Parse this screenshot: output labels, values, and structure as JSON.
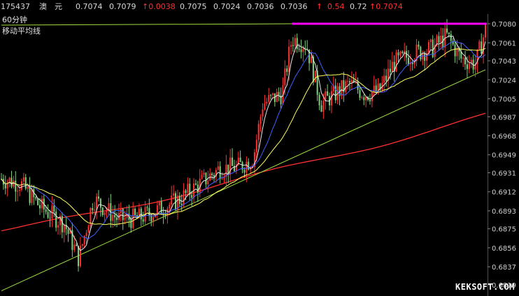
{
  "quote": {
    "code": "175437",
    "name": "澳　元",
    "v1": "0.7074",
    "v2": "0.7079",
    "change": "↑0.0038",
    "v3": "0.7075",
    "v4": "0.7024",
    "v5": "0.7036",
    "v6": "0.7036",
    "arrow": "↑",
    "v7": "0.54",
    "v8": "0.72",
    "v9": "↑0.7074"
  },
  "chart_labels": {
    "period": "60分钟",
    "indicator": "移动平均线"
  },
  "watermark": "KEKSOFT.COM",
  "colors": {
    "background": "#000000",
    "up_candle": "#ff3030",
    "down_candle": "#7fd07f",
    "ma_fast": "#e8e8e8",
    "ma_mid": "#ffff60",
    "ma_blue": "#4060ff",
    "ma_long": "#ff3030",
    "trendline": "#a0e040",
    "resistance": "#ff00ff"
  },
  "chart_data": {
    "type": "candlestick",
    "y_ticks": [
      "0.7080",
      "0.7061",
      "0.7043",
      "0.7024",
      "0.7005",
      "0.6987",
      "0.6968",
      "0.6949",
      "0.6931",
      "0.6912",
      "0.6893",
      "0.6875",
      "0.6856",
      "0.6837",
      "0.6819"
    ],
    "ylim": [
      0.6812,
      0.7087
    ],
    "resistance_level": 0.708,
    "trendline": {
      "start": [
        0,
        0.6813
      ],
      "end": [
        1,
        0.7034
      ]
    },
    "long_ma_start": 0.6873,
    "long_ma_end": 0.6988,
    "path_anchors": [
      [
        0,
        0.6925
      ],
      [
        0.04,
        0.692
      ],
      [
        0.08,
        0.6897
      ],
      [
        0.13,
        0.688
      ],
      [
        0.16,
        0.6845
      ],
      [
        0.19,
        0.6905
      ],
      [
        0.24,
        0.6885
      ],
      [
        0.28,
        0.6885
      ],
      [
        0.33,
        0.6895
      ],
      [
        0.37,
        0.6905
      ],
      [
        0.41,
        0.692
      ],
      [
        0.45,
        0.6935
      ],
      [
        0.49,
        0.6937
      ],
      [
        0.52,
        0.6945
      ],
      [
        0.54,
        0.7
      ],
      [
        0.58,
        0.701
      ],
      [
        0.6,
        0.7065
      ],
      [
        0.63,
        0.706
      ],
      [
        0.66,
        0.7
      ],
      [
        0.69,
        0.701
      ],
      [
        0.72,
        0.702
      ],
      [
        0.75,
        0.701
      ],
      [
        0.78,
        0.7012
      ],
      [
        0.81,
        0.704
      ],
      [
        0.85,
        0.705
      ],
      [
        0.89,
        0.7055
      ],
      [
        0.92,
        0.7068
      ],
      [
        0.95,
        0.7045
      ],
      [
        0.98,
        0.704
      ],
      [
        1.0,
        0.7074
      ]
    ]
  }
}
